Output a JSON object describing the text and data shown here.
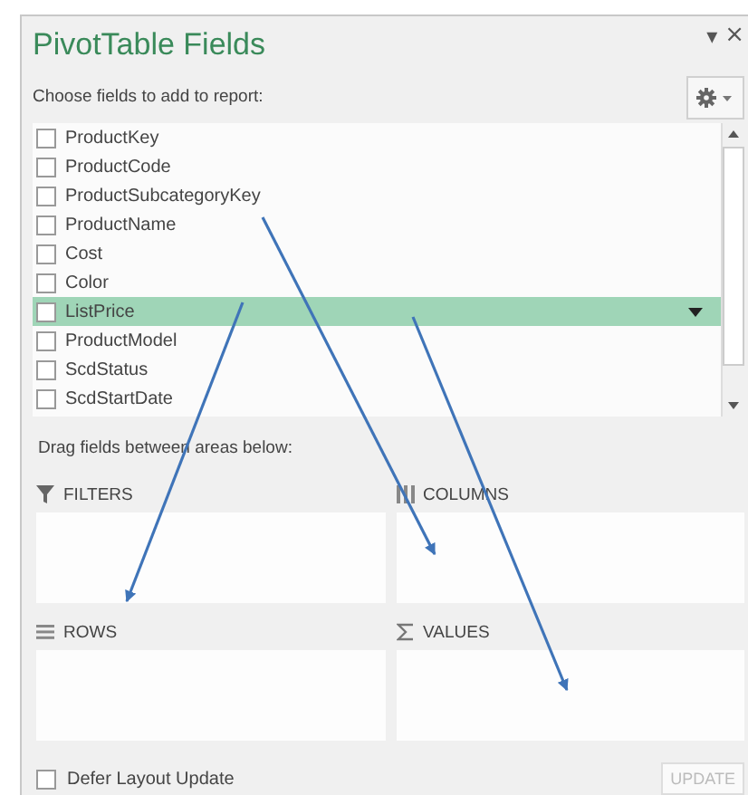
{
  "panel": {
    "title": "PivotTable Fields",
    "menu_glyph": "▾",
    "close_glyph": "×"
  },
  "prompt": "Choose fields to add to report:",
  "fields": [
    {
      "name": "ProductKey",
      "checked": false,
      "selected": false
    },
    {
      "name": "ProductCode",
      "checked": false,
      "selected": false
    },
    {
      "name": "ProductSubcategoryKey",
      "checked": false,
      "selected": false
    },
    {
      "name": "ProductName",
      "checked": false,
      "selected": false
    },
    {
      "name": "Cost",
      "checked": false,
      "selected": false
    },
    {
      "name": "Color",
      "checked": false,
      "selected": false
    },
    {
      "name": "ListPrice",
      "checked": false,
      "selected": true
    },
    {
      "name": "ProductModel",
      "checked": false,
      "selected": false
    },
    {
      "name": "ScdStatus",
      "checked": false,
      "selected": false
    },
    {
      "name": "ScdStartDate",
      "checked": false,
      "selected": false
    }
  ],
  "areas_hint": "Drag fields between areas below:",
  "areas": [
    {
      "label": "FILTERS",
      "kind": "filters"
    },
    {
      "label": "COLUMNS",
      "kind": "columns"
    },
    {
      "label": "ROWS",
      "kind": "rows"
    },
    {
      "label": "VALUES",
      "kind": "values"
    }
  ],
  "defer": {
    "label": "Defer Layout Update",
    "checked": false
  },
  "update_button": {
    "label": "UPDATE",
    "disabled": true
  }
}
